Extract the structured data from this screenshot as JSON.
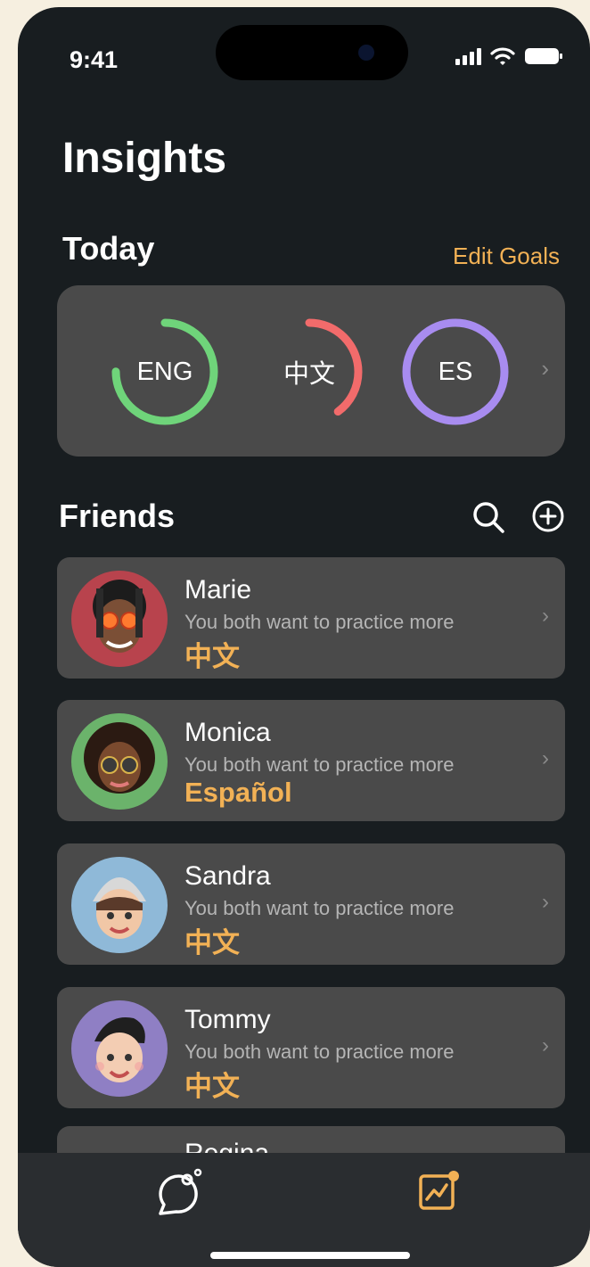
{
  "status": {
    "time": "9:41"
  },
  "header": {
    "title": "Insights"
  },
  "today": {
    "title": "Today",
    "edit_goals": "Edit Goals",
    "goals": [
      {
        "label": "ENG",
        "color": "#6fd47a",
        "progress": 0.75
      },
      {
        "label": "中文",
        "color": "#f26b6b",
        "progress": 0.4
      },
      {
        "label": "ES",
        "color": "#a88cf0",
        "progress": 1.0
      }
    ]
  },
  "friends": {
    "title": "Friends",
    "items": [
      {
        "name": "Marie",
        "subtitle": "You both want to practice more",
        "language": "中文",
        "avatar_color": "#b8434d"
      },
      {
        "name": "Monica",
        "subtitle": "You both want to practice more",
        "language": "Español",
        "avatar_color": "#6bb36b"
      },
      {
        "name": "Sandra",
        "subtitle": "You both want to practice more",
        "language": "中文",
        "avatar_color": "#8fb9d8"
      },
      {
        "name": "Tommy",
        "subtitle": "You both want to practice more",
        "language": "中文",
        "avatar_color": "#8f7fc4"
      },
      {
        "name": "Regina"
      }
    ]
  },
  "colors": {
    "accent": "#f2b155",
    "background": "#181d20",
    "card": "#4a4a4a"
  },
  "tabbar": {
    "items": [
      "chat-bubbles-icon",
      "insights-chart-icon"
    ],
    "active": "insights-chart-icon"
  }
}
